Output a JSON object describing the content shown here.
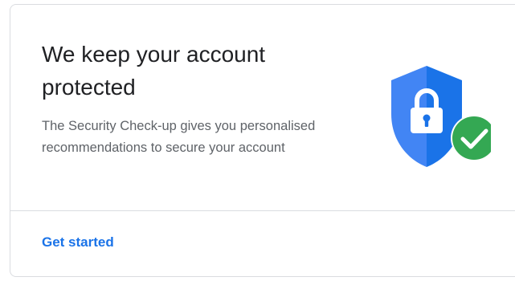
{
  "card": {
    "title": "We keep your account protected",
    "description": "The Security Check-up gives you personalised recommendations to secure your account",
    "action_label": "Get started"
  },
  "colors": {
    "shield_light": "#4285f4",
    "shield_dark": "#1a73e8",
    "check_green": "#34a853",
    "link_blue": "#1a73e8",
    "title_text": "#202124",
    "body_text": "#5f6368",
    "border": "#dadce0"
  },
  "icons": {
    "illustration": "shield-lock-check-icon"
  }
}
